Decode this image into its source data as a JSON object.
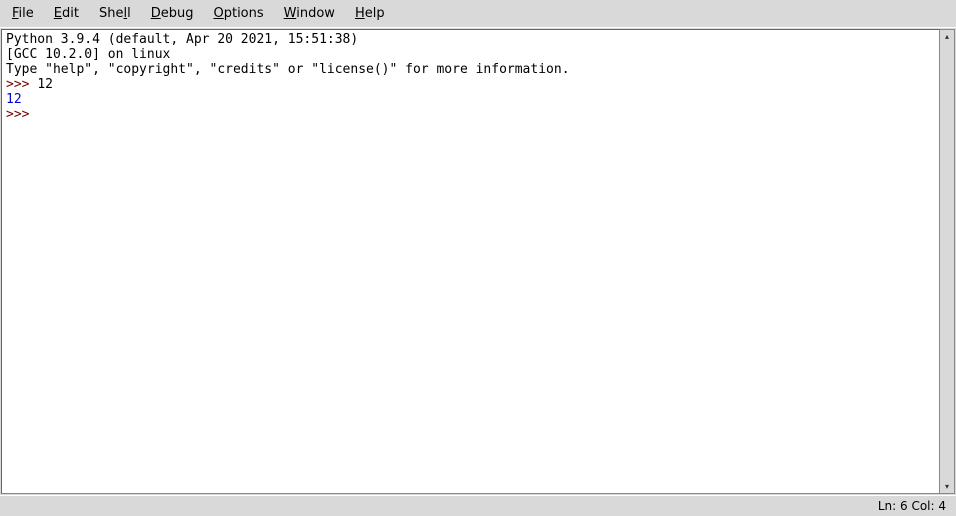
{
  "menu": {
    "file": "File",
    "edit": "Edit",
    "shell": "Shell",
    "debug": "Debug",
    "options": "Options",
    "window": "Window",
    "help": "Help"
  },
  "shell": {
    "line1": "Python 3.9.4 (default, Apr 20 2021, 15:51:38) ",
    "line2": "[GCC 10.2.0] on linux",
    "line3": "Type \"help\", \"copyright\", \"credits\" or \"license()\" for more information.",
    "prompt1": ">>> ",
    "input1": "12",
    "out1": "12",
    "prompt2": ">>> "
  },
  "status": {
    "text": "Ln: 6  Col: 4"
  }
}
